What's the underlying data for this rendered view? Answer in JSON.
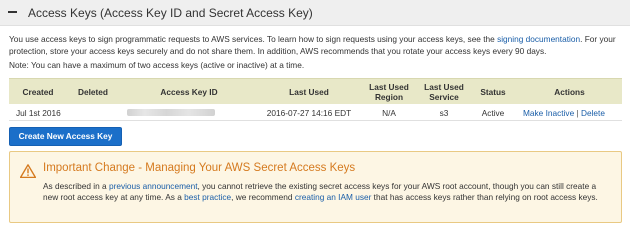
{
  "section": {
    "title": "Access Keys (Access Key ID and Secret Access Key)",
    "collapse_icon": "minus-icon"
  },
  "intro": {
    "text_before_link": "You use access keys to sign programmatic requests to AWS services. To learn how to sign requests using your access keys, see the ",
    "link_text": "signing documentation",
    "text_after_link": ". For your protection, store your access keys securely and do not share them. In addition, AWS recommends that you rotate your access keys every 90 days."
  },
  "note": "Note: You can have a maximum of two access keys (active or inactive) at a time.",
  "table": {
    "headers": {
      "created": "Created",
      "deleted": "Deleted",
      "key_id": "Access Key ID",
      "last_used": "Last Used",
      "last_used_region_1": "Last Used",
      "last_used_region_2": "Region",
      "last_used_service_1": "Last Used",
      "last_used_service_2": "Service",
      "status": "Status",
      "actions": "Actions"
    },
    "rows": [
      {
        "created": "Jul 1st 2016",
        "deleted": "",
        "last_used": "2016-07-27 14:16 EDT",
        "region": "N/A",
        "service": "s3",
        "status": "Active",
        "action_make_inactive": "Make Inactive",
        "separator": "|",
        "action_delete": "Delete"
      }
    ]
  },
  "create_button": "Create New Access Key",
  "alert": {
    "icon": "warning-icon",
    "title": "Important Change - Managing Your AWS Secret Access Keys",
    "p1": "As described in a ",
    "link1": "previous announcement",
    "p2": ", you cannot retrieve the existing secret access keys for your AWS root account, though you can still create a new root access key at any time. As a ",
    "link2": "best practice",
    "p3": ", we recommend ",
    "link3": "creating an IAM user",
    "p4": " that has access keys rather than relying on root access keys."
  },
  "colors": {
    "header_bg": "#efefef",
    "table_header_bg": "#e8e8c8",
    "link": "#1a5ea8",
    "button": "#1b6fc9",
    "alert_bg": "#fdf6e4",
    "alert_border": "#e9c983",
    "alert_title": "#d57a1f"
  }
}
